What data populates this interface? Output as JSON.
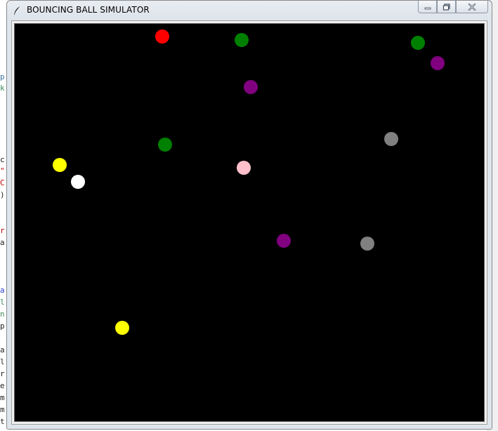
{
  "window": {
    "title": "BOUNCING BALL SIMULATOR",
    "app_icon": "feather-icon",
    "controls": {
      "minimize": "minimize-icon",
      "maximize": "restore-icon",
      "close": "close-icon"
    }
  },
  "background_editor": {
    "visible_chars": [
      "p",
      "k",
      "c",
      "\"",
      "C",
      ")",
      "r",
      "a",
      "a",
      "l",
      "n",
      "p",
      "a",
      "l",
      "r",
      "e",
      "m",
      "m",
      "t"
    ]
  },
  "canvas": {
    "background": "#000000",
    "balls": [
      {
        "color": "#ff0000"
      },
      {
        "color": "#008000"
      },
      {
        "color": "#008000"
      },
      {
        "color": "#800080"
      },
      {
        "color": "#800080"
      },
      {
        "color": "#808080"
      },
      {
        "color": "#008000"
      },
      {
        "color": "#ffc0cb"
      },
      {
        "color": "#ffff00"
      },
      {
        "color": "#ffffff"
      },
      {
        "color": "#800080"
      },
      {
        "color": "#808080"
      },
      {
        "color": "#ffff00"
      }
    ]
  }
}
